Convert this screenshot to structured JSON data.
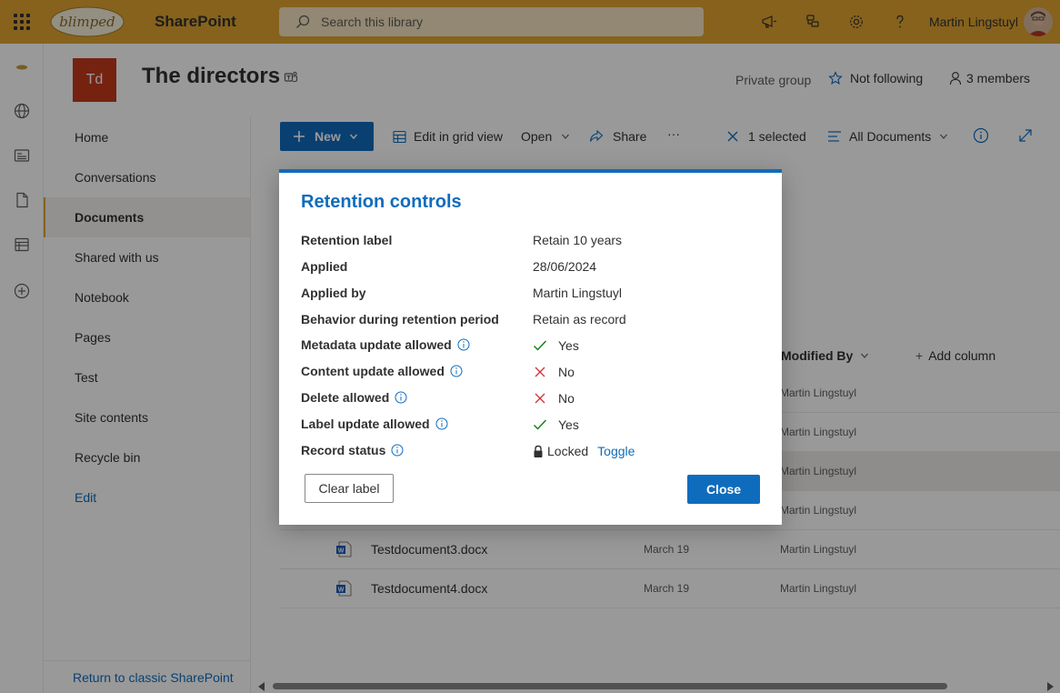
{
  "suite": {
    "app_name": "SharePoint",
    "search_placeholder": "Search this library",
    "user_name": "Martin Lingstuyl"
  },
  "site": {
    "logo_initials": "Td",
    "title": "The directors",
    "privacy": "Private group",
    "follow_label": "Not following",
    "members_label": "3 members"
  },
  "nav": {
    "items": [
      {
        "label": "Home"
      },
      {
        "label": "Conversations"
      },
      {
        "label": "Documents"
      },
      {
        "label": "Shared with us"
      },
      {
        "label": "Notebook"
      },
      {
        "label": "Pages"
      },
      {
        "label": "Test"
      },
      {
        "label": "Site contents"
      },
      {
        "label": "Recycle bin"
      }
    ],
    "edit_label": "Edit",
    "classic_label": "Return to classic SharePoint"
  },
  "commandbar": {
    "new_label": "New",
    "grid_label": "Edit in grid view",
    "open_label": "Open",
    "share_label": "Share",
    "more_label": "···",
    "selected_label": "1 selected",
    "view_label": "All Documents"
  },
  "list": {
    "col_modified_by": "Modified By",
    "col_add": "Add column",
    "rows": [
      {
        "name": "",
        "date": "",
        "by": "Martin Lingstuyl"
      },
      {
        "name": "",
        "date": "",
        "by": "Martin Lingstuyl"
      },
      {
        "name": "",
        "date": "",
        "by": "Martin Lingstuyl"
      },
      {
        "name": "",
        "date": "",
        "by": "Martin Lingstuyl"
      },
      {
        "name": "Testdocument3.docx",
        "date": "March 19",
        "by": "Martin Lingstuyl"
      },
      {
        "name": "Testdocument4.docx",
        "date": "March 19",
        "by": "Martin Lingstuyl"
      }
    ]
  },
  "dialog": {
    "title": "Retention controls",
    "rows": [
      {
        "label": "Retention label",
        "value": "Retain 10 years"
      },
      {
        "label": "Applied",
        "value": "28/06/2024"
      },
      {
        "label": "Applied by",
        "value": "Martin Lingstuyl"
      },
      {
        "label": "Behavior during retention period",
        "value": "Retain as record"
      },
      {
        "label": "Metadata update allowed",
        "value": "Yes",
        "mark": "check-icon"
      },
      {
        "label": "Content update allowed",
        "value": "No",
        "mark": "cross-icon"
      },
      {
        "label": "Delete allowed",
        "value": "No",
        "mark": "cross-icon"
      },
      {
        "label": "Label update allowed",
        "value": "Yes",
        "mark": "check-icon"
      },
      {
        "label": "Record status",
        "value": "Locked",
        "mark": "lock-icon",
        "link": "Toggle"
      }
    ],
    "clear_label": "Clear label",
    "close_label": "Close"
  },
  "colors": {
    "suite_bar": "#e0a431",
    "accent": "#0f6cbd",
    "site_logo": "#c4391d",
    "check": "#107c10",
    "cross": "#d13438"
  }
}
